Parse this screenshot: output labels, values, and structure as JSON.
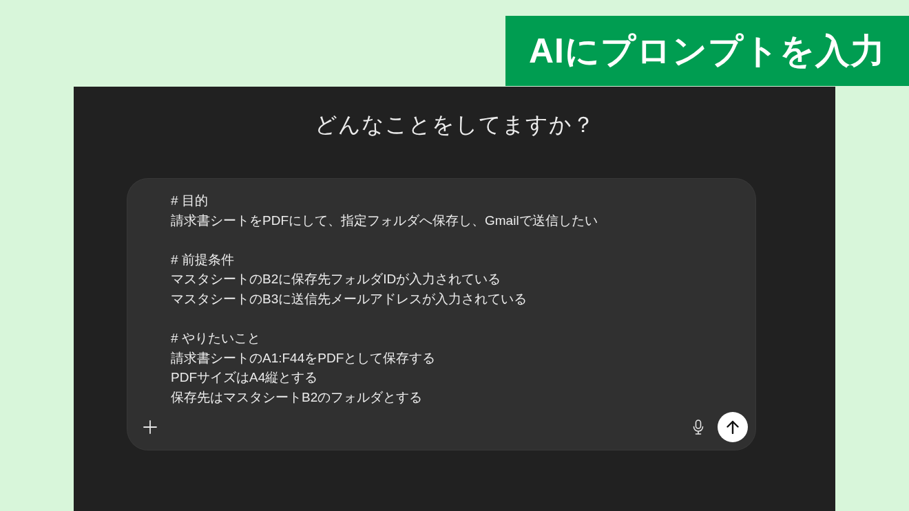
{
  "banner": {
    "title": "AIにプロンプトを入力"
  },
  "chat": {
    "heading": "どんなことをしてますか？",
    "composer": {
      "sections": [
        {
          "heading": "# 目的",
          "lines": [
            "請求書シートをPDFにして、指定フォルダへ保存し、Gmailで送信したい"
          ]
        },
        {
          "heading": "# 前提条件",
          "lines": [
            "マスタシートのB2に保存先フォルダIDが入力されている",
            "マスタシートのB3に送信先メールアドレスが入力されている"
          ]
        },
        {
          "heading": "# やりたいこと",
          "lines": [
            "請求書シートのA1:F44をPDFとして保存する",
            "PDFサイズはA4縦とする",
            "保存先はマスタシートB2のフォルダとする"
          ]
        }
      ]
    }
  }
}
